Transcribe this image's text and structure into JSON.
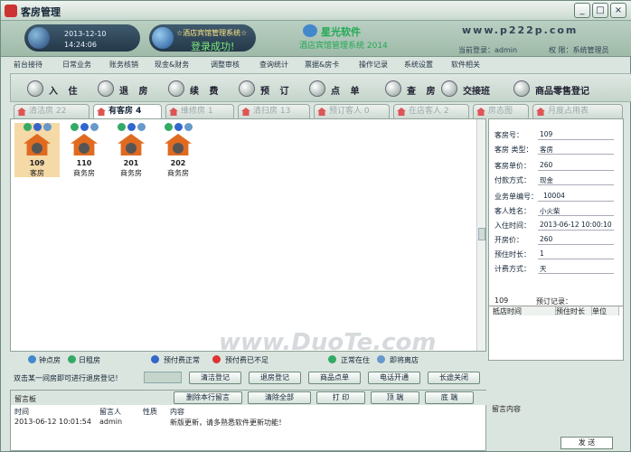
{
  "title": "客房管理",
  "window_controls": [
    "_",
    "□",
    "×"
  ],
  "header": {
    "date": "2013-12-10",
    "time": "14:24:06",
    "system_name": "☆酒店宾馆管理系统☆",
    "login_msg": "登录成功!",
    "brand": "星光软件",
    "brand_sub": "酒店宾馆管理系统 2014",
    "url": "www.p222p.com",
    "current_login": "当前登录：admin",
    "permission": "权  限：系统管理员"
  },
  "menu": [
    "前台接待",
    "日常业务",
    "账务核销",
    "现金&财务",
    "调整审核",
    "查询统计",
    "票据&房卡",
    "操作记录",
    "系统设置",
    "软件相关"
  ],
  "toolbar": [
    "入 住",
    "退 房",
    "续 费",
    "预 订",
    "点 单",
    "查 房",
    "交接班",
    "商品零售登记"
  ],
  "tabs": [
    "清洁房 22",
    "有客房 4",
    "维修房 1",
    "清扫房 13",
    "预订客人 0",
    "在店客人 2",
    "房态图",
    "月度占用表"
  ],
  "rooms": [
    {
      "no": "109",
      "type": "客房"
    },
    {
      "no": "110",
      "type": "商务房"
    },
    {
      "no": "201",
      "type": "商务房"
    },
    {
      "no": "202",
      "type": "商务房"
    }
  ],
  "watermark": "www.DuoTe.com",
  "legend": {
    "hour_room": "钟点房",
    "day_room": "日租房",
    "prepay_ok": "预付费正常",
    "prepay_low": "预付费已不足",
    "normal": "正常在住",
    "leaving": "即将离店"
  },
  "hint": "双击某一间房即可进行退房登记！",
  "buttons": {
    "clean": "清洁登记",
    "checkout": "退房登记",
    "order": "商品点单",
    "phone": "电话开通",
    "call": "长途关闭"
  },
  "message": {
    "label": "留言板",
    "delete_row": "删除本行留言",
    "clear_all": "清除全部",
    "print": "打 印",
    "top": "顶 端",
    "bottom": "底 端",
    "cols": [
      "时间",
      "留言人",
      "性质",
      "内容"
    ],
    "rows": [
      {
        "time": "2013-06-12 10:01:54",
        "user": "admin",
        "nature": "",
        "content": "新版更新，请多熟悉软件更新功能！"
      }
    ],
    "side_label": "留言内容",
    "send": "发 送"
  },
  "detail": {
    "room_no_label": "客房号：",
    "room_no": "109",
    "room_type_label": "客房 类型：",
    "room_type": "客房",
    "price_label": "客房单价：",
    "price": "260",
    "pay_label": "付款方式：",
    "pay": "现金",
    "bill_label": "业务单编号：",
    "bill": "10004",
    "name_label": "客人姓名：",
    "name": "小火柴",
    "checkin_label": "入住时间：",
    "checkin": "2013-06-12 10:00:10",
    "rate_label": "开房价：",
    "rate": "260",
    "stay_label": "预住时长：",
    "stay": "1",
    "calc_label": "计费方式：",
    "calc": "天"
  },
  "booking": {
    "room": "109",
    "label": "预订记录：",
    "cols": [
      "抵店时间",
      "预住时长",
      "单位"
    ]
  }
}
